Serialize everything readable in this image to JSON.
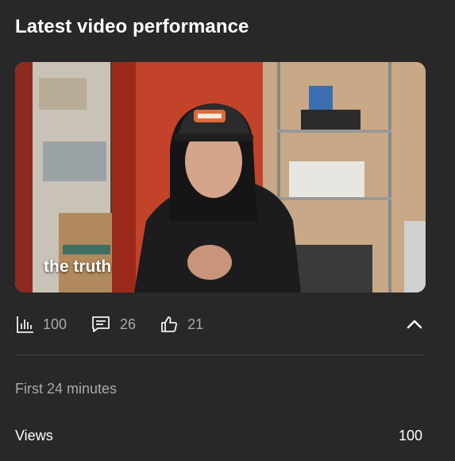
{
  "card": {
    "title": "Latest video performance",
    "video": {
      "caption": "the truth"
    },
    "stats": {
      "views": "100",
      "comments": "26",
      "likes": "21"
    },
    "period": "First 24 minutes",
    "metrics": [
      {
        "label": "Views",
        "value": "100"
      }
    ]
  },
  "icons": {
    "views": "bar-chart-icon",
    "comments": "comment-icon",
    "likes": "thumbs-up-icon",
    "collapse": "chevron-up-icon"
  },
  "colors": {
    "background": "#282828",
    "text_primary": "#ffffff",
    "text_secondary": "#aaaaaa",
    "divider": "#3f3f3f"
  }
}
